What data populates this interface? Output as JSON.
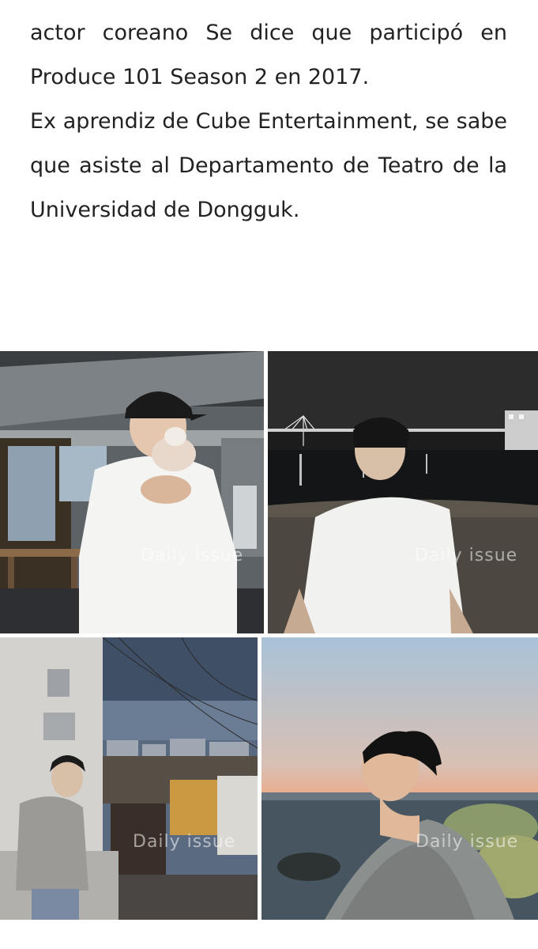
{
  "article": {
    "paragraph_1": "actor coreano Se dice que participó en Produce 101 Season 2 en 2017.",
    "paragraph_2": "Ex aprendiz de Cube Entertainment, se sabe que asiste al Departamento de Teatro de la Universidad de Dongguk."
  },
  "photos": [
    {
      "watermark": "Daily issue"
    },
    {
      "watermark": "Daily issue"
    },
    {
      "watermark": "Daily issue"
    },
    {
      "watermark": "Daily issue"
    }
  ],
  "colors": {
    "text": "#222222",
    "background": "#ffffff",
    "watermark": "#ffffff"
  }
}
